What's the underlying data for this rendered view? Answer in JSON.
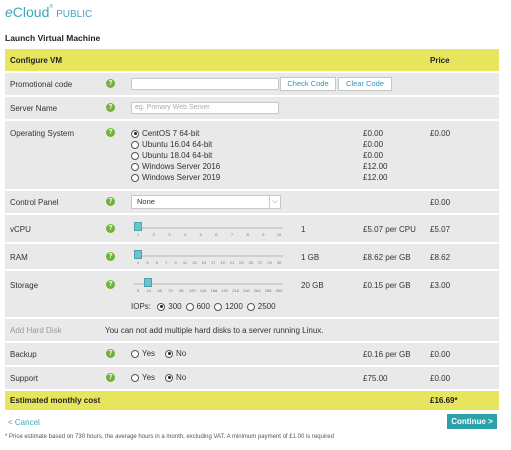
{
  "brand": {
    "e": "e",
    "name": "Cloud",
    "tm": "®",
    "suffix": "PUBLIC"
  },
  "page_title": "Launch Virtual Machine",
  "header": {
    "title": "Configure VM",
    "price": "Price"
  },
  "promo": {
    "label": "Promotional code",
    "value": "",
    "check": "Check Code",
    "clear": "Clear Code"
  },
  "server_name": {
    "label": "Server Name",
    "placeholder": "eg. Primary Web Server"
  },
  "os": {
    "label": "Operating System",
    "price": "£0.00",
    "options": [
      {
        "name": "CentOS 7 64-bit",
        "cost": "£0.00",
        "selected": true
      },
      {
        "name": "Ubuntu 16.04 64-bit",
        "cost": "£0.00",
        "selected": false
      },
      {
        "name": "Ubuntu 18.04 64-bit",
        "cost": "£0.00",
        "selected": false
      },
      {
        "name": "Windows Server 2016",
        "cost": "£12.00",
        "selected": false
      },
      {
        "name": "Windows Server 2019",
        "cost": "£12.00",
        "selected": false
      }
    ]
  },
  "control_panel": {
    "label": "Control Panel",
    "value": "None",
    "price": "£0.00"
  },
  "vcpu": {
    "label": "vCPU",
    "value": "1",
    "unit_cost": "£5.07 per CPU",
    "price": "£5.07",
    "ticks": [
      "1",
      "2",
      "3",
      "4",
      "5",
      "6",
      "7",
      "8",
      "9",
      "10"
    ],
    "level": 0
  },
  "ram": {
    "label": "RAM",
    "value": "1 GB",
    "unit_cost": "£8.62 per GB",
    "price": "£8.62",
    "ticks": [
      "1",
      "3",
      "5",
      "7",
      "9",
      "11",
      "13",
      "15",
      "17",
      "19",
      "21",
      "23",
      "25",
      "27",
      "29",
      "30"
    ],
    "level": 0
  },
  "storage": {
    "label": "Storage",
    "value": "20 GB",
    "unit_cost": "£0.15 per GB",
    "price": "£3.00",
    "ticks": [
      "0",
      "24",
      "48",
      "72",
      "96",
      "120",
      "144",
      "168",
      "192",
      "216",
      "240",
      "264",
      "288",
      "300"
    ],
    "level": 0.067,
    "iops_label": "IOPs:",
    "iops": [
      {
        "v": "300",
        "selected": true
      },
      {
        "v": "600",
        "selected": false
      },
      {
        "v": "1200",
        "selected": false
      },
      {
        "v": "2500",
        "selected": false
      }
    ]
  },
  "add_disk": {
    "label": "Add Hard Disk",
    "message": "You can not add multiple hard disks to a server running Linux."
  },
  "backup": {
    "label": "Backup",
    "yes": "Yes",
    "no": "No",
    "unit_cost": "£0.16 per GB",
    "price": "£0.00"
  },
  "support": {
    "label": "Support",
    "yes": "Yes",
    "no": "No",
    "unit_cost": "£75.00",
    "price": "£0.00"
  },
  "total": {
    "label": "Estimated monthly cost",
    "price": "£16.69*"
  },
  "cancel": "< Cancel",
  "continue": "Continue >",
  "footnote": "* Price estimate based on 730 hours, the average hours in a month, excluding VAT. A minimum payment of £1.00 is required",
  "colors": {
    "accent": "#2ba3a8",
    "header": "#e7e55e",
    "help": "#6fb23a"
  }
}
